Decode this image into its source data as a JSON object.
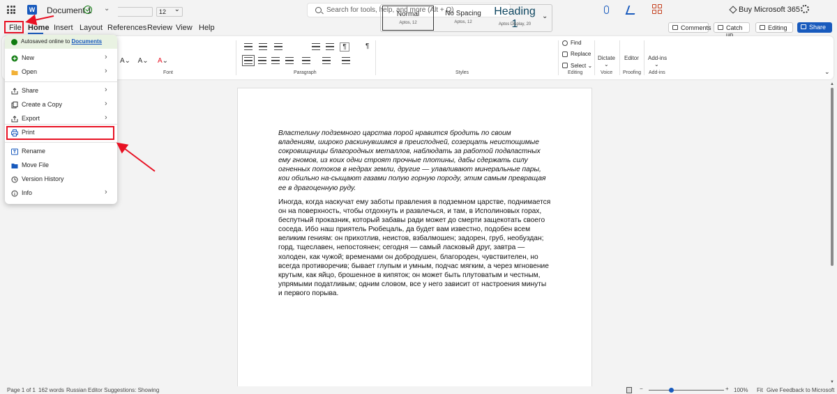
{
  "titlebar": {
    "app_title": "Document 1",
    "search_placeholder": "Search for tools, help, and more (Alt + Q)",
    "buy_label": "Buy Microsoft 365",
    "word_letter": "W"
  },
  "menu_tabs": {
    "file": "File",
    "home": "Home",
    "insert": "Insert",
    "layout": "Layout",
    "references": "References",
    "review": "Review",
    "view": "View",
    "help": "Help"
  },
  "right_buttons": {
    "comments": "Comments",
    "catch_up": "Catch up",
    "editing": "Editing",
    "share": "Share"
  },
  "ribbon": {
    "font_size": "12",
    "font_group": "Font",
    "paragraph_group": "Paragraph",
    "styles_group": "Styles",
    "editing_group": "Editing",
    "voice_group": "Voice",
    "proofing_group": "Proofing",
    "addins_group": "Add-ins",
    "styles": [
      {
        "title": "Normal",
        "sub": "Aptos, 12"
      },
      {
        "title": "No Spacing",
        "sub": "Aptos, 12"
      },
      {
        "title": "Heading 1",
        "sub": "Aptos Display, 20"
      }
    ],
    "find": "Find",
    "replace": "Replace",
    "select": "Select",
    "dictate": "Dictate",
    "editor": "Editor",
    "addins": "Add-ins"
  },
  "file_menu": {
    "autosave_text": "Autosaved online to",
    "autosave_link": "Documents",
    "items": [
      {
        "label": "New",
        "icon": "new-icon",
        "arrow": true
      },
      {
        "label": "Open",
        "icon": "folder-icon",
        "arrow": true
      },
      {
        "label": "Share",
        "icon": "share-icon",
        "arrow": true
      },
      {
        "label": "Create a Copy",
        "icon": "copy-icon",
        "arrow": true
      },
      {
        "label": "Export",
        "icon": "export-icon",
        "arrow": true
      },
      {
        "label": "Print",
        "icon": "printer-icon",
        "arrow": false
      },
      {
        "label": "Rename",
        "icon": "rename-icon",
        "arrow": false
      },
      {
        "label": "Move File",
        "icon": "move-icon",
        "arrow": false
      },
      {
        "label": "Version History",
        "icon": "history-icon",
        "arrow": false
      },
      {
        "label": "Info",
        "icon": "info-icon",
        "arrow": true
      }
    ]
  },
  "document": {
    "paragraph_1": "Властелину подземного царства порой нравится бродить по своим владениям, широко раскинувшимся в преисподней, созерцать неистощимые сокровищницы благородных металлов, наблюдать за работой подвластных ему гномов, из коих одни строят прочные плотины, дабы сдержать силу огненных потоков в недрах  земли, другие — улавливают минеральные пары, кои обильно на-сыщают газами полую горную породу, этим самым превращая ее в драгоценную руду.",
    "paragraph_2": "Иногда, когда наскучат ему заботы правления в подземном царстве, поднимается он на поверхность, чтобы отдохнуть и развлечься, и там, в Исполиновых горах, беспутный проказник, который забавы ради может до смерти защекотать своего соседа. Ибо наш приятель Рюбецаль, да будет вам известно, подобен всем великим гениям: он прихотлив, неистов, взбалмошен; задорен, груб, необуздан; горд, тщеславен, непостоянен; сегодня — самый ласковый друг, завтра — холоден, как чужой; временами он добродушен, благороден, чувствителен, но всегда противоречив; бывает глупым и умным, подчас мягким, а через мгновение крутым, как яйцо, брошенное в кипяток; он может быть плутоватым и честным, упрямыми  податливым; одним  словом, все у него зависит от настроения минуты и первого порыва."
  },
  "statusbar": {
    "page": "Page 1 of 1",
    "words": "162 words",
    "language": "Russian",
    "editor_suggestions": "Editor Suggestions: Showing",
    "zoom": "100%",
    "fit": "Fit",
    "feedback": "Give Feedback to Microsoft"
  },
  "colors": {
    "accent": "#185abd",
    "highlight_red": "#e81123",
    "autosave_green": "#107c10"
  }
}
